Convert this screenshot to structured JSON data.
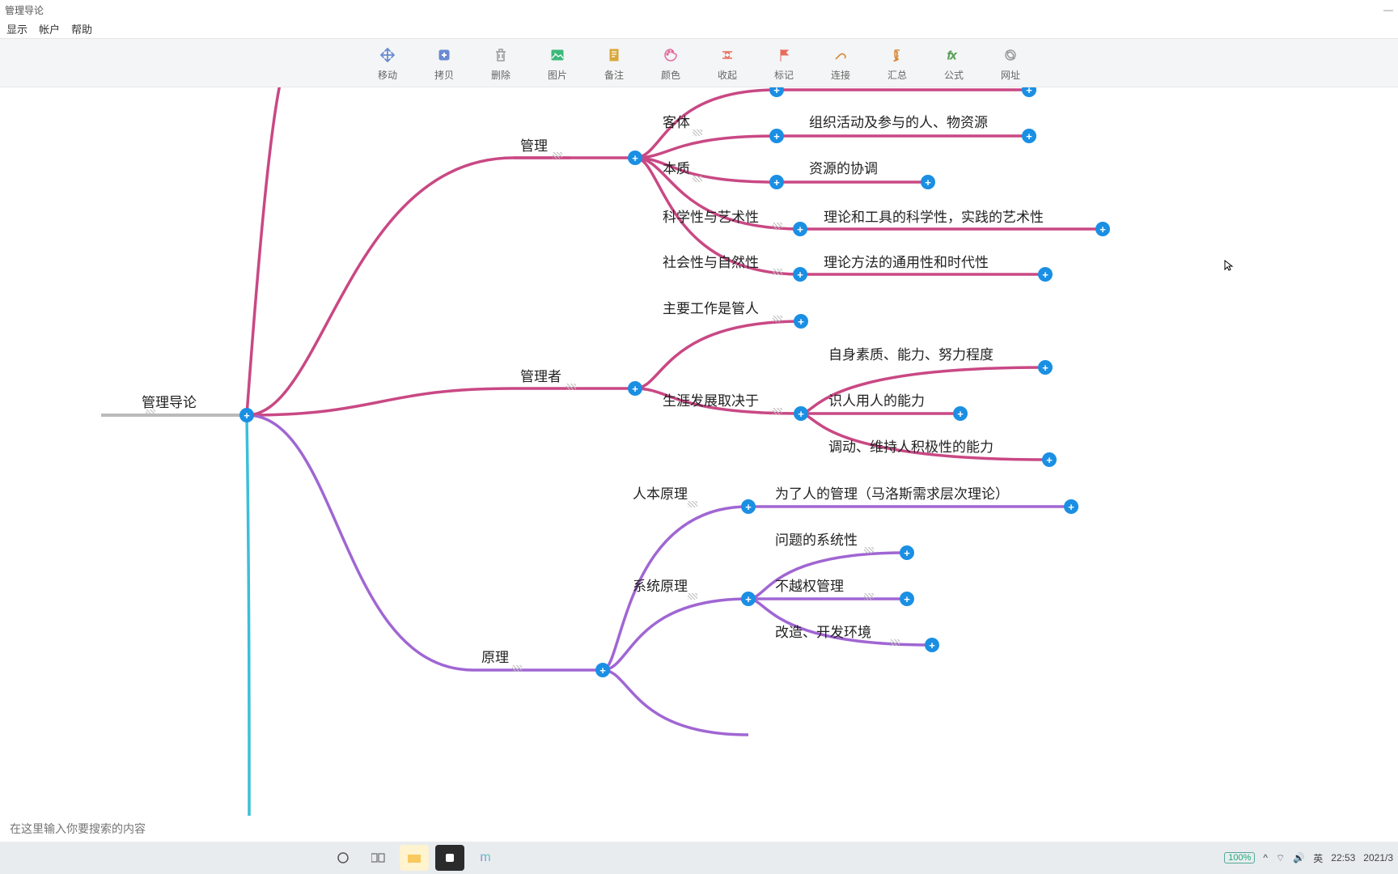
{
  "title": "管理导论",
  "menu": [
    "显示",
    "帐户",
    "帮助"
  ],
  "toolbar": [
    {
      "label": "移动",
      "icon": "move",
      "color": "#6a8bd1"
    },
    {
      "label": "拷贝",
      "icon": "copy",
      "color": "#6a8bd1"
    },
    {
      "label": "删除",
      "icon": "trash",
      "color": "#999"
    },
    {
      "label": "图片",
      "icon": "image",
      "color": "#3cb97a"
    },
    {
      "label": "备注",
      "icon": "note",
      "color": "#d9a83a"
    },
    {
      "label": "颜色",
      "icon": "palette",
      "color": "#e46a9a"
    },
    {
      "label": "收起",
      "icon": "collapse",
      "color": "#e86b5a"
    },
    {
      "label": "标记",
      "icon": "flag",
      "color": "#e86b5a"
    },
    {
      "label": "连接",
      "icon": "link",
      "color": "#d98a3a"
    },
    {
      "label": "汇总",
      "icon": "sum",
      "color": "#d98a3a"
    },
    {
      "label": "公式",
      "icon": "fx",
      "color": "#5aa05a"
    },
    {
      "label": "网址",
      "icon": "url",
      "color": "#999"
    }
  ],
  "root_label": "管理导论",
  "nodes": {
    "mgmt": "管理",
    "mgmt_keti": "客体",
    "mgmt_keti_leaf": "组织活动及参与的人、物资源",
    "mgmt_benzhi": "本质",
    "mgmt_benzhi_leaf": "资源的协调",
    "mgmt_sci": "科学性与艺术性",
    "mgmt_sci_leaf": "理论和工具的科学性，实践的艺术性",
    "mgmt_soc": "社会性与自然性",
    "mgmt_soc_leaf": "理论方法的通用性和时代性",
    "manager": "管理者",
    "manager_main": "主要工作是管人",
    "career": "生涯发展取决于",
    "career_1": "自身素质、能力、努力程度",
    "career_2": "识人用人的能力",
    "career_3": "调动、维持人积极性的能力",
    "principle": "原理",
    "p_renben": "人本原理",
    "p_renben_leaf": "为了人的管理（马洛斯需求层次理论）",
    "p_sys": "系统原理",
    "p_sys_1": "问题的系统性",
    "p_sys_2": "不越权管理",
    "p_sys_3": "改造、开发环境"
  },
  "search_placeholder": "在这里输入你要搜索的内容",
  "tray": {
    "zoom": "100%",
    "ime": "英",
    "time": "22:53",
    "date": "2021/3"
  }
}
